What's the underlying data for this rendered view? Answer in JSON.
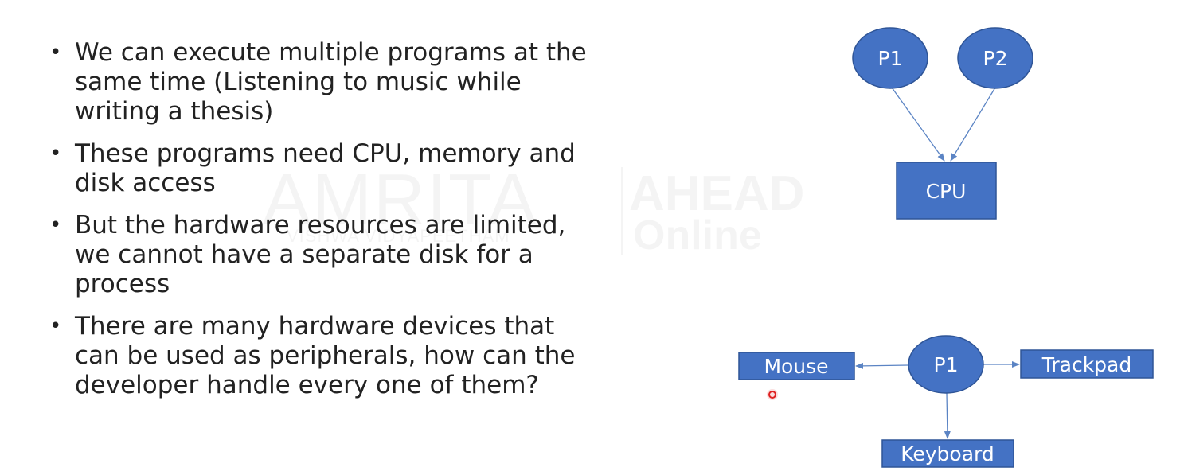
{
  "bullets": [
    "We can execute multiple programs at the same time (Listening to music while writing a thesis)",
    "These programs need CPU, memory and disk access",
    "But the hardware resources are limited, we cannot have a separate disk for a process",
    "There are many hardware devices that can be used as peripherals, how can the developer handle every one of them?"
  ],
  "watermark": {
    "brand": "AMRITA",
    "sub": "VISHWA VIDYAPEETHAM",
    "ahead": "AHEAD",
    "online": "Online"
  },
  "diagram_top": {
    "node_p1": "P1",
    "node_p2": "P2",
    "node_cpu": "CPU"
  },
  "diagram_bottom": {
    "node_p1": "P1",
    "node_mouse": "Mouse",
    "node_trackpad": "Trackpad",
    "node_keyboard": "Keyboard"
  },
  "colors": {
    "node_fill": "#4472C4",
    "node_stroke": "#2F5597",
    "arrow": "#5B84C4",
    "pointer": "#E02020"
  }
}
